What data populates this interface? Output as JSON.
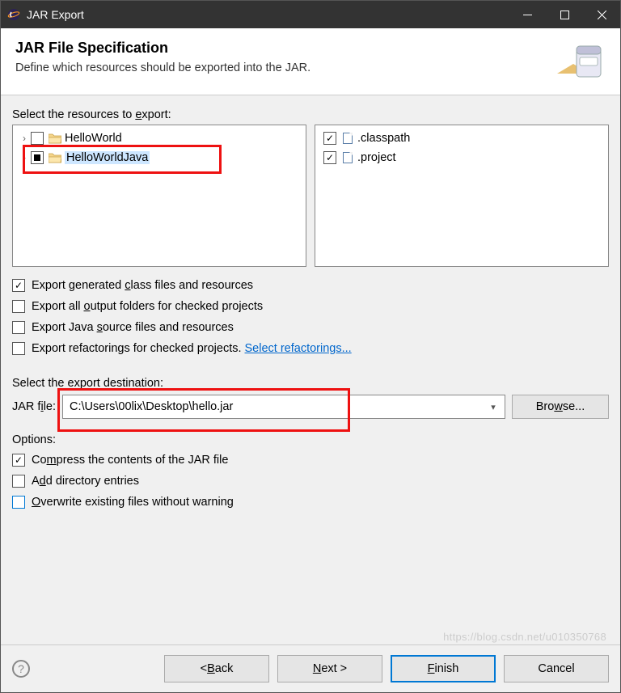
{
  "window": {
    "title": "JAR Export"
  },
  "banner": {
    "heading": "JAR File Specification",
    "subheading": "Define which resources should be exported into the JAR."
  },
  "resources": {
    "label": "Select the resources to export:",
    "left": [
      {
        "name": "HelloWorld",
        "state": "unchecked",
        "selected": false
      },
      {
        "name": "HelloWorldJava",
        "state": "partial",
        "selected": true
      }
    ],
    "right": [
      {
        "name": ".classpath",
        "state": "checked"
      },
      {
        "name": ".project",
        "state": "checked"
      }
    ]
  },
  "exportOptions": {
    "genclass": {
      "label_pre": "Export generated ",
      "u": "c",
      "label_post": "lass files and resources",
      "checked": true
    },
    "outputfolders": {
      "label_pre": "Export all ",
      "u": "o",
      "label_post": "utput folders for checked projects",
      "checked": false
    },
    "sourcefiles": {
      "label_pre": "Export Java ",
      "u": "s",
      "label_post": "ource files and resources",
      "checked": false
    },
    "refactorings": {
      "label": "Export refactorings for checked projects.",
      "link": "Select refactorings...",
      "checked": false
    }
  },
  "destination": {
    "label": "Select the export destination:",
    "field_label_pre": "JAR f",
    "field_label_u": "i",
    "field_label_post": "le:",
    "value": "C:\\Users\\00lix\\Desktop\\hello.jar",
    "browse_pre": "Bro",
    "browse_u": "w",
    "browse_post": "se..."
  },
  "options": {
    "label": "Options:",
    "compress": {
      "label_pre": "Co",
      "u": "m",
      "label_post": "press the contents of the JAR file",
      "checked": true
    },
    "adddir": {
      "label_pre": "A",
      "u": "d",
      "label_post": "d directory entries",
      "checked": false
    },
    "overwrite": {
      "u": "O",
      "label_post": "verwrite existing files without warning",
      "checked": false
    }
  },
  "buttons": {
    "back_pre": "< ",
    "back_u": "B",
    "back_post": "ack",
    "next_u": "N",
    "next_post": "ext >",
    "finish_u": "F",
    "finish_post": "inish",
    "cancel": "Cancel"
  },
  "expander_glyph": "›",
  "watermark": "https://blog.csdn.net/u010350768"
}
